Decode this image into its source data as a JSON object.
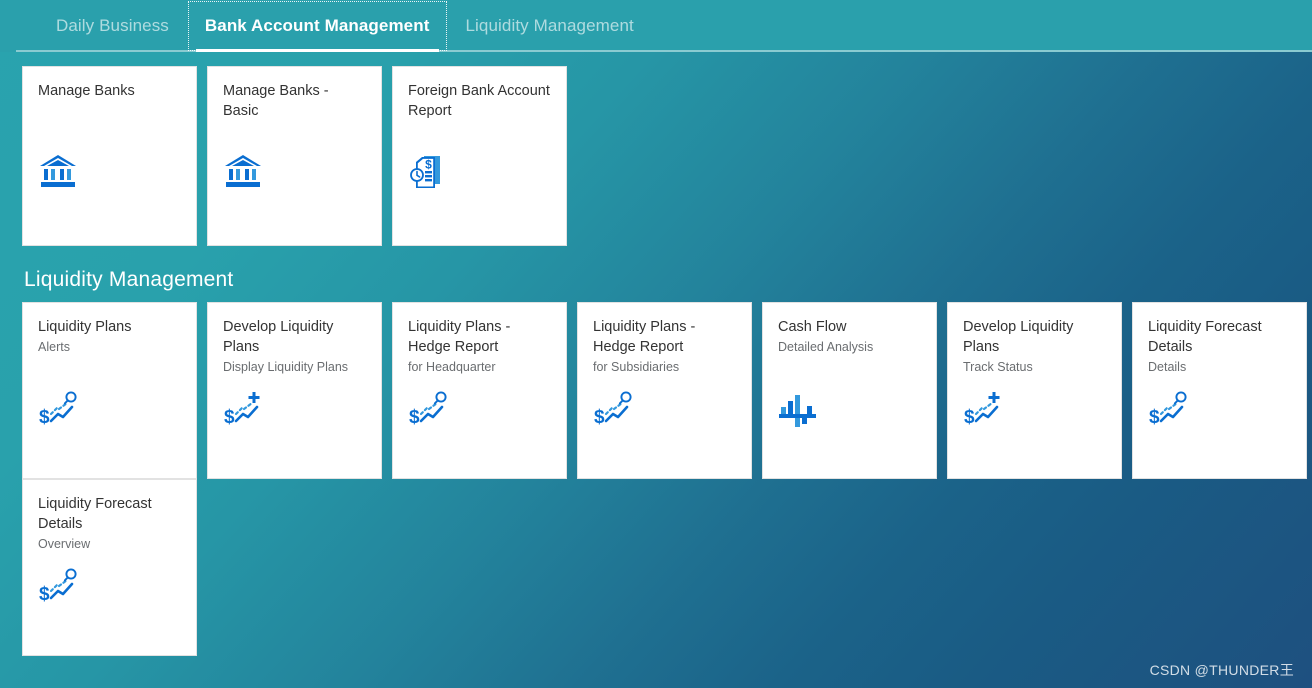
{
  "tabs": [
    {
      "label": "Daily Business",
      "selected": false
    },
    {
      "label": "Bank Account Management",
      "selected": true
    },
    {
      "label": "Liquidity Management",
      "selected": false
    }
  ],
  "ghost_heading": "Bank Account Management",
  "colors": {
    "bg_top_left": "#29a3ae",
    "bg_bottom_right": "#1e5080",
    "tabbar": "#2aa0ac",
    "tile_bg": "#ffffff",
    "tile_border": "#e2e2e2",
    "icon_accent": "#0a6ed1",
    "title_text": "#333333",
    "subtitle_text": "#6a6d70"
  },
  "groups": [
    {
      "title": "",
      "rows": [
        [
          {
            "title": "Manage Banks",
            "subtitle": "",
            "icon": "bank-icon"
          },
          {
            "title": "Manage Banks - Basic",
            "subtitle": "",
            "icon": "bank-icon"
          },
          {
            "title": "Foreign Bank Account Report",
            "subtitle": "",
            "icon": "document-money-clock-icon"
          }
        ]
      ]
    },
    {
      "title": "Liquidity Management",
      "rows": [
        [
          {
            "title": "Liquidity Plans",
            "subtitle": "Alerts",
            "icon": "money-trend-search-icon"
          },
          {
            "title": "Develop Liquidity Plans",
            "subtitle": "Display Liquidity Plans",
            "icon": "money-trend-plus-icon"
          },
          {
            "title": "Liquidity Plans - Hedge Report",
            "subtitle": "for Headquarter",
            "icon": "money-trend-search-icon"
          },
          {
            "title": "Liquidity Plans - Hedge Report",
            "subtitle": "for Subsidiaries",
            "icon": "money-trend-search-icon"
          },
          {
            "title": "Cash Flow",
            "subtitle": "Detailed Analysis",
            "icon": "bar-chart-icon"
          },
          {
            "title": "Develop Liquidity Plans",
            "subtitle": "Track Status",
            "icon": "money-trend-plus-icon"
          },
          {
            "title": "Liquidity Forecast Details",
            "subtitle": "Details",
            "icon": "money-trend-search-icon"
          }
        ],
        [
          {
            "title": "Liquidity Forecast Details",
            "subtitle": "Overview",
            "icon": "money-trend-search-icon"
          }
        ]
      ]
    }
  ],
  "watermark": "CSDN @THUNDER王"
}
